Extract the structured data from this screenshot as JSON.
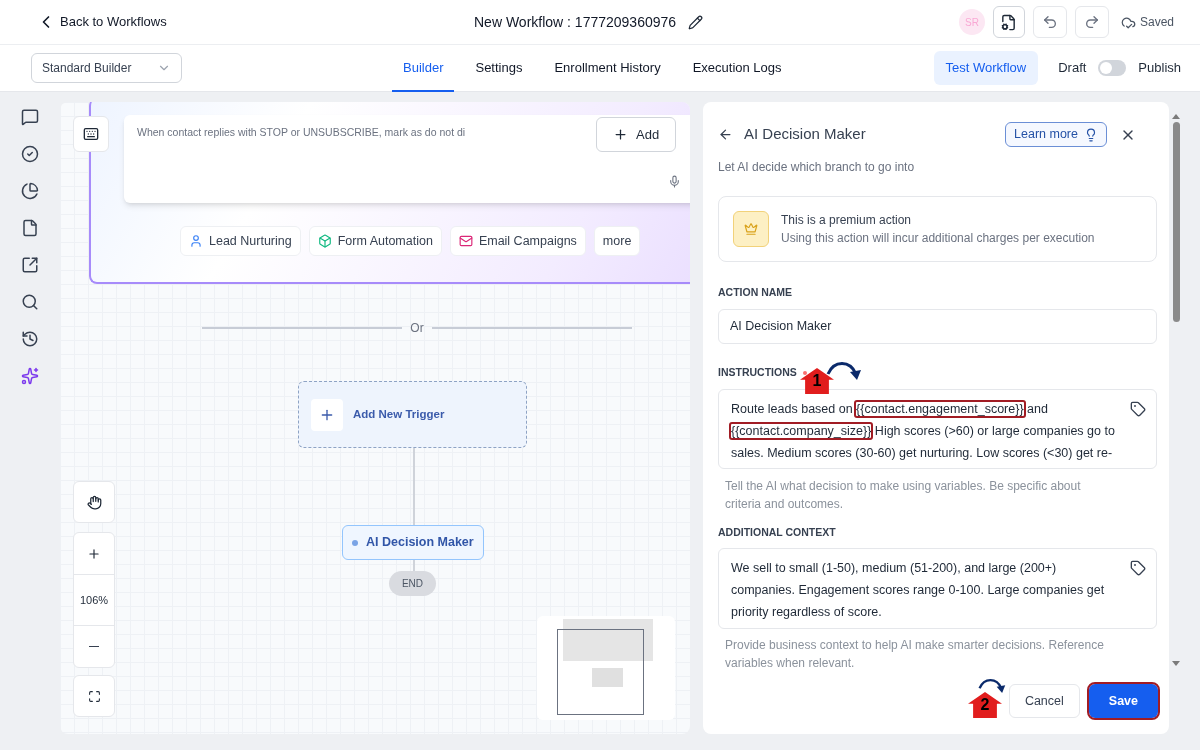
{
  "header": {
    "back": "Back to Workflows",
    "title": "New Workflow : 1777209360976",
    "avatar": "SR",
    "status": "Saved"
  },
  "builder_select": {
    "value": "Standard Builder"
  },
  "tabs": [
    {
      "label": "Builder",
      "selected": true
    },
    {
      "label": "Settings",
      "selected": false
    },
    {
      "label": "Enrollment History",
      "selected": false
    },
    {
      "label": "Execution Logs",
      "selected": false
    }
  ],
  "test_button": "Test Workflow",
  "publish_toggle": {
    "off_label": "Draft",
    "on_label": "Publish",
    "on": false
  },
  "sidebar_items": [
    {
      "kind": "chat",
      "selected": false
    },
    {
      "kind": "check",
      "selected": false
    },
    {
      "kind": "pie",
      "selected": false
    },
    {
      "kind": "file",
      "selected": false
    },
    {
      "kind": "external",
      "selected": false
    },
    {
      "kind": "search",
      "selected": false
    },
    {
      "kind": "history",
      "selected": false
    },
    {
      "kind": "sparkles",
      "selected": true
    }
  ],
  "canvas": {
    "prompt": {
      "placeholder": "When contact replies with STOP or UNSUBSCRIBE, mark as do not di",
      "add": "Add"
    },
    "chips": [
      {
        "label": "Lead Nurturing",
        "kind": "person"
      },
      {
        "label": "Form Automation",
        "kind": "cube"
      },
      {
        "label": "Email Campaigns",
        "kind": "mail"
      },
      {
        "label": "more",
        "kind": "plain"
      }
    ],
    "divider": "Or",
    "trigger": "Add New Trigger",
    "node": "AI Decision Maker",
    "end": "END",
    "zoom": "106%"
  },
  "panel": {
    "title": "AI Decision Maker",
    "learn_more": "Learn more",
    "subtitle": "Let AI decide which branch to go into",
    "premium": {
      "title": "This is a premium action",
      "text": "Using this action will incur additional charges per execution"
    },
    "action_name": {
      "label": "ACTION NAME",
      "value": "AI Decision Maker"
    },
    "instructions": {
      "label": "INSTRUCTIONS",
      "required": true,
      "parts": [
        {
          "text": "Route leads based on ",
          "highlighted": false
        },
        {
          "text": "{{contact.engagement_score}}",
          "highlighted": true
        },
        {
          "text": " and ",
          "highlighted": false
        },
        {
          "text": "{{contact.company_size}}",
          "highlighted": true
        },
        {
          "text": " High scores (>60) or large companies go to sales. Medium scores (30-60) get nurturing. Low scores (<30) get re-",
          "highlighted": false
        }
      ],
      "help": "Tell the AI what decision to make using variables. Be specific about criteria and outcomes."
    },
    "context": {
      "label": "ADDITIONAL CONTEXT",
      "value": "We sell to small (1-50), medium (51-200), and large (200+) companies. Engagement scores range 0-100. Large companies get priority regardless of score.",
      "help": "Provide business context to help AI make smarter decisions. Reference variables when relevant."
    },
    "cancel": "Cancel",
    "save": {
      "label": "Save",
      "highlighted": true
    }
  },
  "annotations": [
    {
      "number": "1"
    },
    {
      "number": "2"
    }
  ]
}
